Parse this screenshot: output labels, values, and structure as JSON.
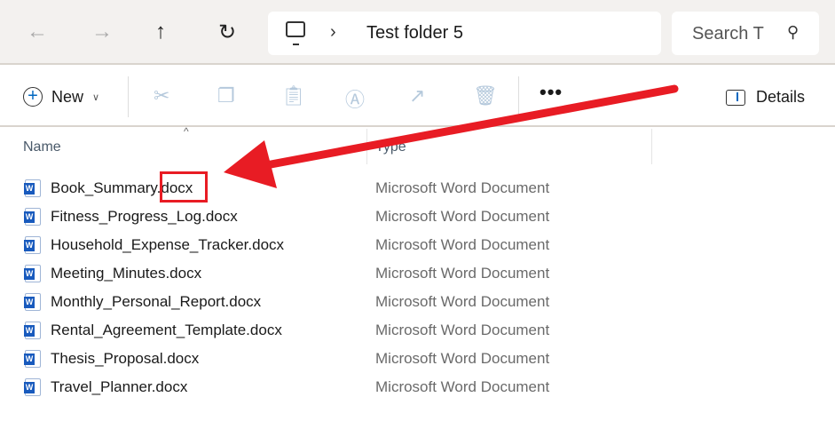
{
  "nav": {
    "back": "←",
    "forward": "→",
    "up": "↑",
    "refresh": "↻"
  },
  "address": {
    "chevron": "›",
    "path": "Test folder 5"
  },
  "search": {
    "placeholder": "Search T"
  },
  "toolbar": {
    "new_label": "New",
    "more": "•••",
    "details_label": "Details"
  },
  "columns": {
    "name": "Name",
    "type": "Type"
  },
  "files": [
    {
      "name": "Book_Summary.docx",
      "type": "Microsoft Word Document"
    },
    {
      "name": "Fitness_Progress_Log.docx",
      "type": "Microsoft Word Document"
    },
    {
      "name": "Household_Expense_Tracker.docx",
      "type": "Microsoft Word Document"
    },
    {
      "name": "Meeting_Minutes.docx",
      "type": "Microsoft Word Document"
    },
    {
      "name": "Monthly_Personal_Report.docx",
      "type": "Microsoft Word Document"
    },
    {
      "name": "Rental_Agreement_Template.docx",
      "type": "Microsoft Word Document"
    },
    {
      "name": "Thesis_Proposal.docx",
      "type": "Microsoft Word Document"
    },
    {
      "name": "Travel_Planner.docx",
      "type": "Microsoft Word Document"
    }
  ],
  "annotation_color": "#e81c24"
}
